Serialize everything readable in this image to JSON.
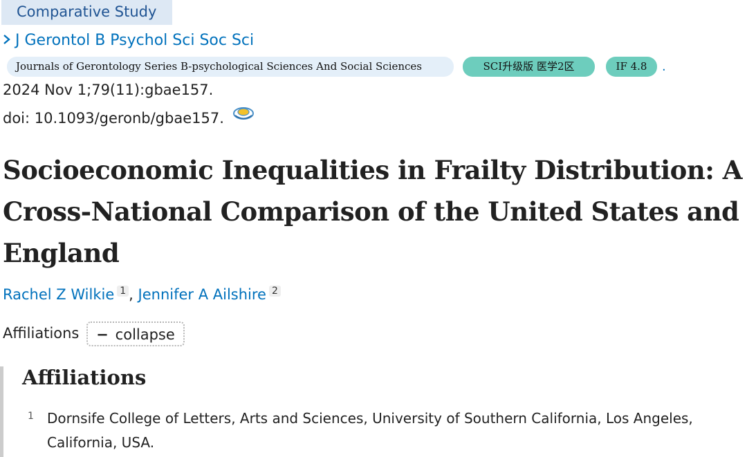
{
  "publication_type": "Comparative Study",
  "journal": {
    "abbrev": "J Gerontol B Psychol Sci Soc Sci",
    "full_name": "Journals of Gerontology Series B-psychological Sciences And Social Sciences",
    "sci_badge": "SCI升级版 医学2区",
    "impact_factor": "IF 4.8",
    "trailing_dot": "."
  },
  "citation": "2024 Nov 1;79(11):gbae157.",
  "doi": "doi: 10.1093/geronb/gbae157.",
  "title": "Socioeconomic Inequalities in Frailty Distribution: A Cross-National Comparison of the United States and England",
  "authors": [
    {
      "name": "Rachel Z Wilkie",
      "affiliation": "1"
    },
    {
      "name": "Jennifer A Ailshire",
      "affiliation": "2"
    }
  ],
  "author_separator": ",",
  "affiliations_toggle": {
    "label": "Affiliations",
    "button_symbol": "−",
    "button_text": "collapse"
  },
  "affiliations_panel": {
    "heading": "Affiliations",
    "items": [
      {
        "number": "1",
        "text": "Dornsife College of Letters, Arts and Sciences, University of Southern California, Los Angeles, California, USA."
      }
    ]
  },
  "colors": {
    "link": "#0071bc",
    "badge_teal": "#6dcdbd",
    "badge_light": "#e4eff9",
    "pubtype_bg": "#dde8f4"
  }
}
